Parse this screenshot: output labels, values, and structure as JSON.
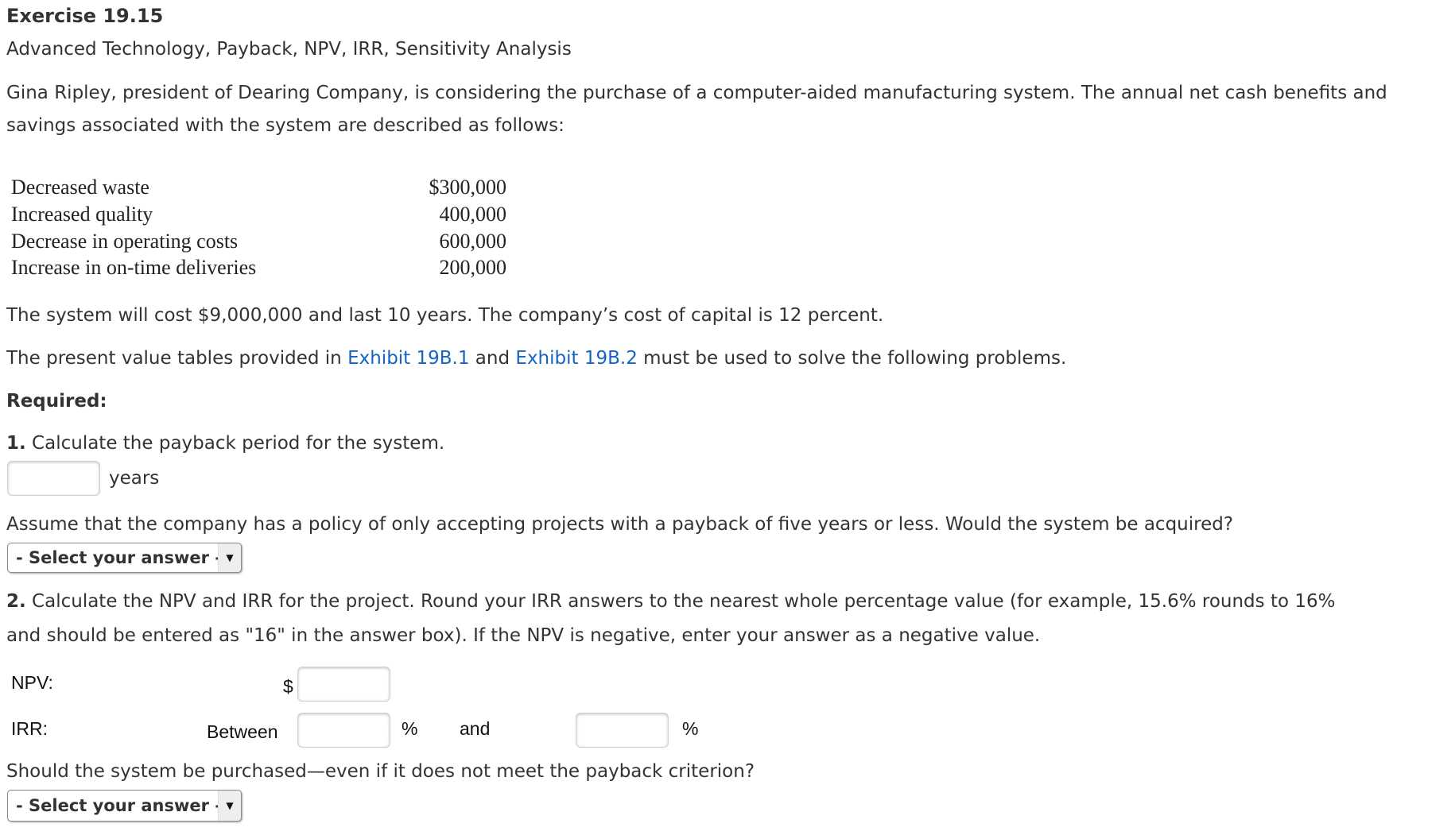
{
  "header": {
    "title": "Exercise 19.15",
    "subtitle": "Advanced Technology, Payback, NPV, IRR, Sensitivity Analysis"
  },
  "intro": {
    "line1": "Gina Ripley, president of Dearing Company, is considering the purchase of a computer-aided manufacturing system. The annual net cash benefits and",
    "line2": "savings associated with the system are described as follows:"
  },
  "benefits_table": {
    "rows": [
      {
        "label": "Decreased waste",
        "value": "$300,000"
      },
      {
        "label": "Increased quality",
        "value": "400,000"
      },
      {
        "label": "Decrease in operating costs",
        "value": "600,000"
      },
      {
        "label": "Increase in on-time deliveries",
        "value": "200,000"
      }
    ]
  },
  "cost_text": "The system will cost $9,000,000 and last 10 years. The company’s cost of capital is 12 percent.",
  "exhibit_text": {
    "before": "The present value tables provided in ",
    "link1": "Exhibit 19B.1",
    "middle": " and ",
    "link2": "Exhibit 19B.2",
    "after": " must be used to solve the following problems."
  },
  "required_label": "Required:",
  "q1": {
    "number": "1.",
    "text": " Calculate the payback period for the system.",
    "input_value": "",
    "unit": "years",
    "followup": "Assume that the company has a policy of only accepting projects with a payback of five years or less. Would the system be acquired?",
    "select_value": "- Select your answer -"
  },
  "q2": {
    "number": "2.",
    "line1": " Calculate the NPV and IRR for the project. Round your IRR answers to the nearest whole percentage value (for example, 15.6% rounds to 16%",
    "line2": "and should be entered as \"16\" in the answer box). If the NPV is negative, enter your answer as a negative value.",
    "npv_label": "NPV:",
    "npv_currency": "$",
    "npv_value": "",
    "irr_label": "IRR:",
    "irr_between": "Between",
    "irr_low_value": "",
    "irr_pct1": "%",
    "irr_and": "and",
    "irr_high_value": "",
    "irr_pct2": "%",
    "followup": "Should the system be purchased—even if it does not meet the payback criterion?",
    "select_value": "- Select your answer -"
  },
  "icons": {
    "dropdown_arrow": "▼"
  }
}
